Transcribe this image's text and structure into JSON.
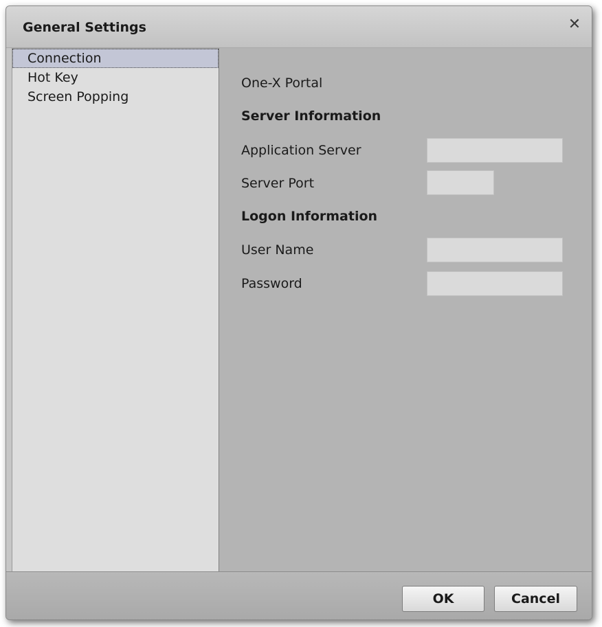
{
  "dialog": {
    "title": "General Settings",
    "close_icon": "close-icon"
  },
  "sidebar": {
    "items": [
      {
        "label": "Connection",
        "selected": true
      },
      {
        "label": "Hot Key",
        "selected": false
      },
      {
        "label": "Screen Popping",
        "selected": false
      }
    ]
  },
  "connection": {
    "portal_label": "One-X Portal",
    "server_section": "Server Information",
    "application_server_label": "Application Server",
    "application_server_value": "",
    "server_port_label": "Server Port",
    "server_port_value": "",
    "logon_section": "Logon Information",
    "user_name_label": "User Name",
    "user_name_value": "",
    "password_label": "Password",
    "password_value": ""
  },
  "footer": {
    "ok_label": "OK",
    "cancel_label": "Cancel"
  }
}
